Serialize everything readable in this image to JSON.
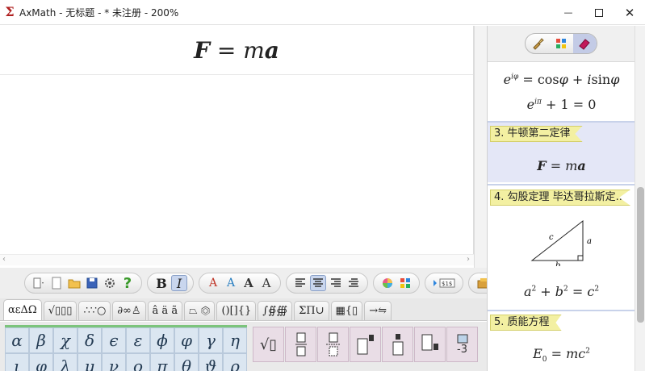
{
  "window": {
    "title": "AxMath - 无标题 - * 未注册 - 200%",
    "app_icon": "Σ",
    "minimize": "—",
    "close": "✕"
  },
  "editor": {
    "formula": {
      "lhs": "F",
      "eq": " = ",
      "m": "m",
      "a": "a"
    }
  },
  "hscroll": {
    "left": "‹",
    "right": "›"
  },
  "toolbar": {
    "bold": "B",
    "italic": "I",
    "font_buttons": [
      "A",
      "A",
      "A",
      "A"
    ],
    "align_icons": [
      "align-left-icon",
      "align-center-icon",
      "align-right-icon",
      "align-justify-icon"
    ]
  },
  "symbol_tabs": [
    "αεΔΩ",
    "√▯▯▯",
    "∴∵○",
    "∂∞♙",
    "â ä ã",
    "⏢ ⏣",
    "()[]{}",
    "∫∯∰",
    "ΣΠ∪",
    "▦{▯",
    "→⇋"
  ],
  "greek_row": [
    "α",
    "β",
    "χ",
    "δ",
    "ϵ",
    "ε",
    "ϕ",
    "φ",
    "γ",
    "η"
  ],
  "greek_row2": [
    "ι",
    "φ",
    "λ",
    "μ",
    "ν",
    "ο",
    "π",
    "θ",
    "ϑ",
    "ρ"
  ],
  "template_labels": {
    "sqrt": "√▯",
    "sub_num": "-3"
  },
  "panel": {
    "euler_line1": {
      "e": "e",
      "exp": "iφ",
      "eq": " = cos",
      "phi": "φ",
      "plus": " + ",
      "i": "i",
      "sin": "sin",
      "phi2": "φ"
    },
    "euler_line2": {
      "e": "e",
      "exp": "iπ",
      "rest": " + 1 = 0"
    },
    "entry3_title": "3. 牛顿第二定律",
    "entry3_formula": {
      "F": "F",
      "eq": " = ",
      "m": "m",
      "a": "a"
    },
    "entry4_title": "4. 勾股定理 毕达哥拉斯定...",
    "triangle_labels": {
      "a": "a",
      "b": "b",
      "c": "c"
    },
    "pythag": {
      "a": "a",
      "sa": "2",
      "p": " + ",
      "b": "b",
      "sb": "2",
      "eq": " = ",
      "c": "c",
      "sc": "2"
    },
    "entry5_title": "5. 质能方程",
    "energy": {
      "E": "E",
      "sub": "0",
      "eq": " = ",
      "m": "m",
      "c": "c",
      "sup": "2"
    }
  }
}
